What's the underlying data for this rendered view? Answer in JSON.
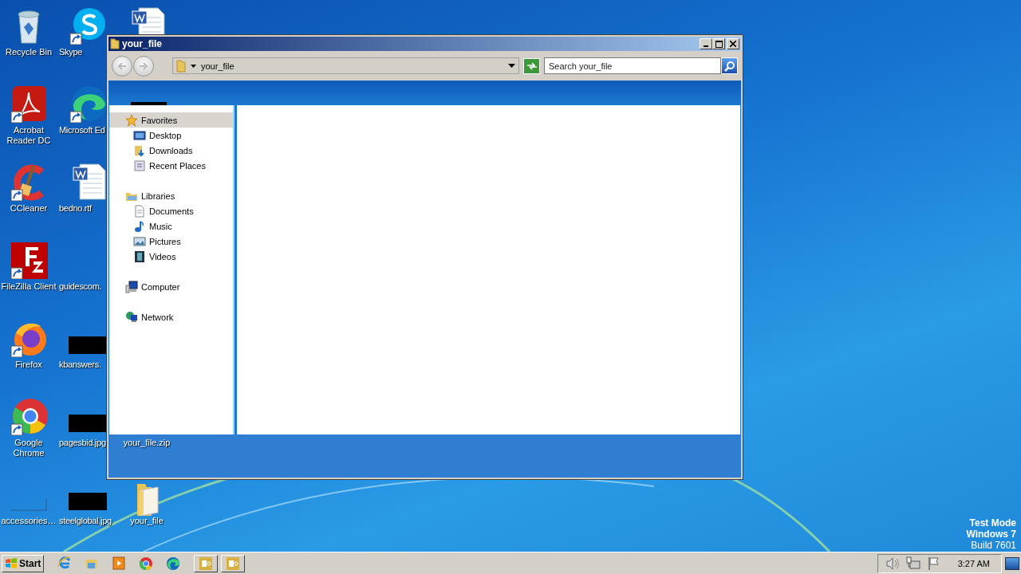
{
  "desktop_icons": [
    {
      "label": "Recycle Bin",
      "kind": "recycle"
    },
    {
      "label": "Acrobat Reader DC",
      "kind": "acrobat",
      "shortcut": true
    },
    {
      "label": "CCleaner",
      "kind": "ccleaner",
      "shortcut": true
    },
    {
      "label": "FileZilla Client",
      "kind": "filezilla",
      "shortcut": true
    },
    {
      "label": "Firefox",
      "kind": "firefox",
      "shortcut": true
    },
    {
      "label": "Google Chrome",
      "kind": "chrome",
      "shortcut": true
    },
    {
      "label": "accessories…",
      "kind": "blank"
    },
    {
      "label": "Skype",
      "kind": "skype",
      "shortcut": true
    },
    {
      "label": "Microsoft Ed",
      "kind": "edge",
      "shortcut": true
    },
    {
      "label": "bedno.rtf",
      "kind": "word"
    },
    {
      "label": "guidescom.",
      "kind": "none"
    },
    {
      "label": "kbanswers.",
      "kind": "redacted"
    },
    {
      "label": "pagesbid.jpg",
      "kind": "redacted"
    },
    {
      "label": "steelglobal.jpg",
      "kind": "redacted"
    },
    {
      "kind": "word"
    },
    {
      "kind": "none"
    },
    {
      "kind": "none"
    },
    {
      "kind": "none"
    },
    {
      "kind": "none"
    },
    {
      "label": "your_file.zip",
      "kind": "none"
    },
    {
      "label": "your_file",
      "kind": "folder"
    }
  ],
  "window": {
    "title": "your_file",
    "address": "your_file",
    "search": {
      "placeholder": "Search your_file"
    },
    "nav": [
      {
        "label": "Favorites",
        "kind": "star",
        "selected": true,
        "children": [
          {
            "label": "Desktop",
            "kind": "desktop",
            "selected": false
          },
          {
            "label": "Downloads",
            "kind": "downloads",
            "selected": false
          },
          {
            "label": "Recent Places",
            "kind": "recent",
            "selected": false
          }
        ]
      },
      {
        "label": "Libraries",
        "kind": "libraries",
        "selected": false,
        "children": [
          {
            "label": "Documents",
            "kind": "documents",
            "selected": false
          },
          {
            "label": "Music",
            "kind": "music",
            "selected": false
          },
          {
            "label": "Pictures",
            "kind": "pictures",
            "selected": false
          },
          {
            "label": "Videos",
            "kind": "videos",
            "selected": false
          }
        ]
      },
      {
        "label": "Computer",
        "kind": "computer",
        "selected": false
      },
      {
        "label": "Network",
        "kind": "network",
        "selected": false
      }
    ]
  },
  "taskbar": {
    "start": "Start",
    "quick_launch": [
      {
        "kind": "ie"
      },
      {
        "kind": "explorer"
      },
      {
        "kind": "media"
      },
      {
        "kind": "chrome"
      },
      {
        "kind": "edge"
      }
    ],
    "tasks": [
      {
        "kind": "app"
      },
      {
        "kind": "app"
      }
    ],
    "tray": [
      {
        "kind": "speaker"
      },
      {
        "kind": "network"
      },
      {
        "kind": "flag"
      }
    ],
    "clock": "3:27 AM"
  },
  "system_notice": [
    "Test Mode",
    "Windows 7",
    "Build 7601"
  ]
}
